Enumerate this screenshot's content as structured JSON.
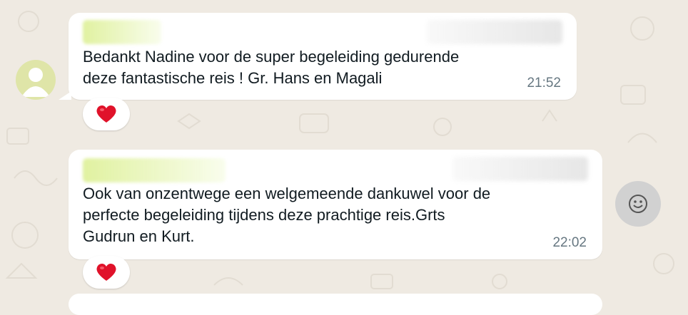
{
  "messages": [
    {
      "text": "Bedankt Nadine voor de super begeleiding gedurende\ndeze fantastische reis ! Gr. Hans en Magali",
      "time": "21:52",
      "reaction": "❤️"
    },
    {
      "text": "Ook van onzentwege een welgemeende dankuwel voor de\nperfecte begeleiding tijdens deze prachtige reis.Grts\nGudrun en Kurt.",
      "time": "22:02",
      "reaction": "❤️"
    }
  ],
  "icons": {
    "avatar": "default-person-avatar-icon",
    "emoji_button": "smiley-face-icon",
    "reaction": "red-heart-emoji"
  },
  "colors": {
    "background": "#efeae2",
    "bubble": "#ffffff",
    "text": "#111b21",
    "timestamp": "#667781",
    "avatar_bg": "#dfe5a8",
    "sender_name_blurred": "#c9e37a"
  }
}
